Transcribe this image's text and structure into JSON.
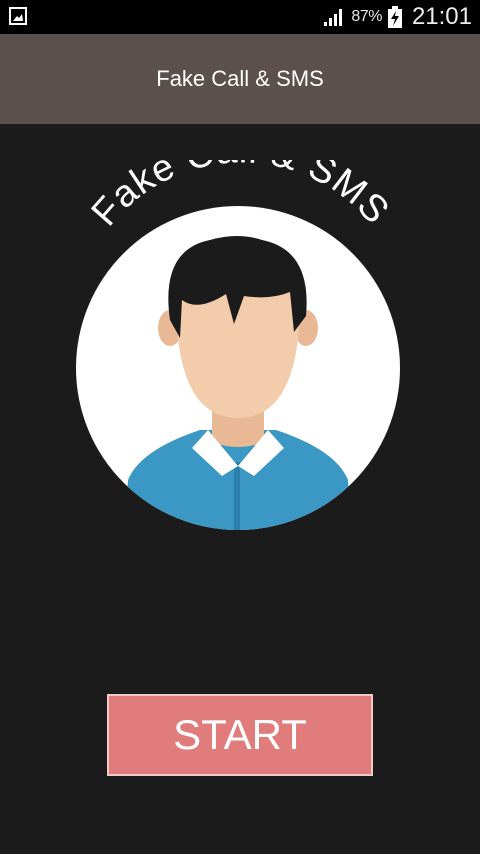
{
  "status_bar": {
    "battery_percent": "87%",
    "time": "21:01",
    "icons": [
      "image-notification-icon",
      "signal-icon",
      "battery-charging-icon"
    ]
  },
  "app_bar": {
    "title": "Fake Call & SMS"
  },
  "logo": {
    "curved_text": "Fake Call & SMS"
  },
  "main": {
    "start_label": "START"
  },
  "colors": {
    "status_bar_bg": "#000000",
    "app_bar_bg": "#5c504c",
    "page_bg": "#1b1b1b",
    "start_button_bg": "#e07c7c",
    "start_button_border": "#f1c9c9",
    "shirt": "#3b97c4",
    "hair": "#1b1b1b",
    "skin": "#f3ccab"
  }
}
